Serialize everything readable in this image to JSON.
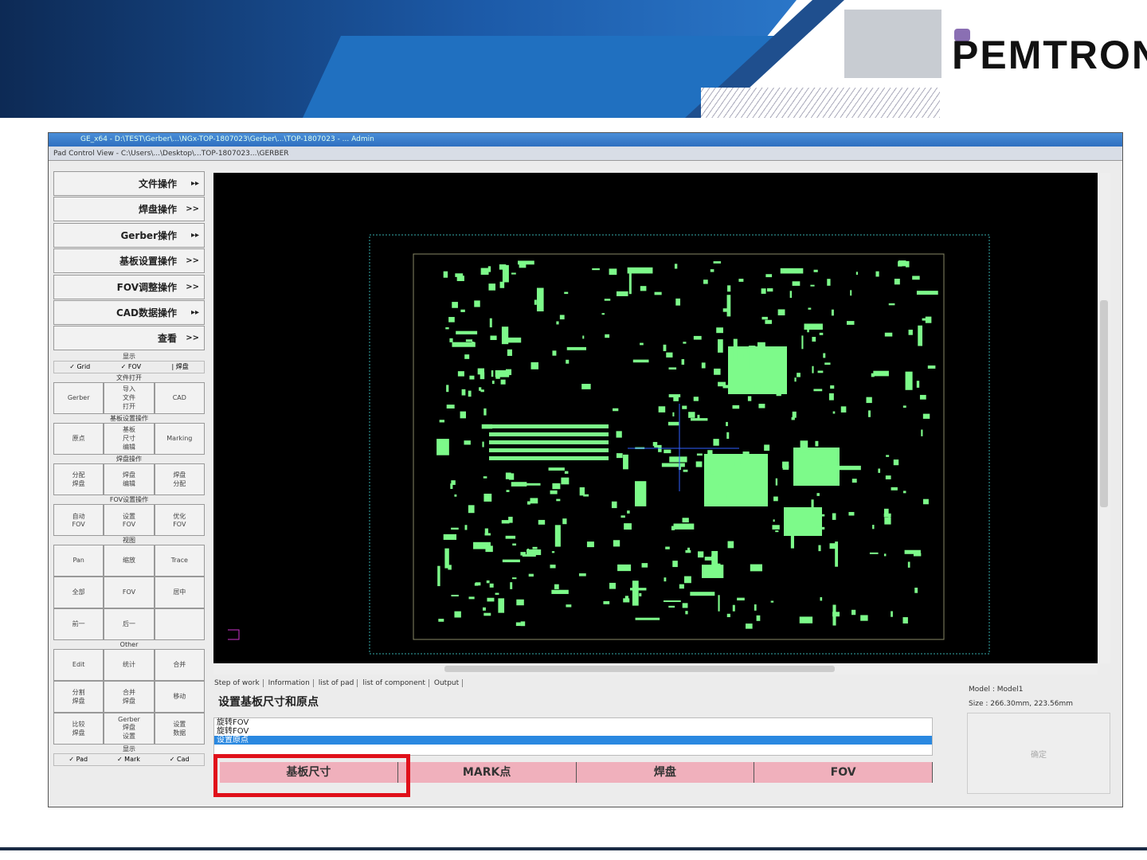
{
  "logo": "PEMTRON",
  "window": {
    "title": "GE_x64 - D:\\TEST\\Gerber\\...\\NGx-TOP-1807023\\Gerber\\...\\TOP-1807023 - ... Admin",
    "subtitle": "Pad Control View - C:\\Users\\...\\Desktop\\...TOP-1807023...\\GERBER"
  },
  "left_menu": [
    {
      "label": "文件操作",
      "arrow": "▸▸"
    },
    {
      "label": "焊盘操作",
      "arrow": ">>"
    },
    {
      "label": "Gerber操作",
      "arrow": "▸▸"
    },
    {
      "label": "基板设置操作",
      "arrow": ">>"
    },
    {
      "label": "FOV调整操作",
      "arrow": ">>"
    },
    {
      "label": "CAD数据操作",
      "arrow": "▸▸"
    },
    {
      "label": "查看",
      "arrow": ">>"
    }
  ],
  "left_groups": {
    "display": {
      "title": "显示",
      "checks": [
        "✓ Grid",
        "✓ FOV",
        "| 焊盘"
      ]
    },
    "g1": {
      "title": "文件打开",
      "buttons": [
        "Gerber",
        "导入\n文件\n打开",
        "CAD"
      ]
    },
    "g2": {
      "title": "基板设置操作",
      "buttons": [
        "原点",
        "基板\n尺寸\n编辑",
        "Marking"
      ]
    },
    "g3": {
      "title": "焊盘操作",
      "buttons": [
        "分配\n焊盘",
        "焊盘\n编辑",
        "焊盘\n分配"
      ]
    },
    "g4": {
      "title": "FOV设置操作",
      "buttons": [
        "自动\nFOV",
        "设置\nFOV",
        "优化\nFOV"
      ]
    },
    "g5": {
      "title": "视图",
      "buttons": [
        "Pan",
        "缩放",
        "Trace",
        "全部",
        "FOV",
        "居中",
        "前一",
        "后一",
        ""
      ]
    },
    "g6": {
      "title": "Other",
      "buttons": [
        "Edit",
        "统计",
        "合并",
        "分割\n焊盘",
        "合并\n焊盘",
        "移动",
        "比较\n焊盘",
        "Gerber\n焊盘\n设置",
        "设置\n数据"
      ]
    },
    "g7": {
      "title": "显示",
      "checks": [
        "✓ Pad",
        "✓ Mark",
        "✓ Cad"
      ]
    }
  },
  "tabs": [
    "Step of work",
    "Information",
    "list of pad",
    "list of component",
    "Output"
  ],
  "step_title": "设置基板尺寸和原点",
  "step_list": [
    "旋转FOV",
    "旋转FOV",
    "设置原点"
  ],
  "step_buttons": [
    "基板尺寸",
    "MARK点",
    "焊盘",
    "FOV"
  ],
  "info": {
    "model": "Model : Model1",
    "size": "Size : 266.30mm, 223.56mm",
    "ok": "确定"
  },
  "colors": {
    "pad": "#7dfa8a",
    "highlight": "#e0101a",
    "button": "#f0b0bc"
  }
}
